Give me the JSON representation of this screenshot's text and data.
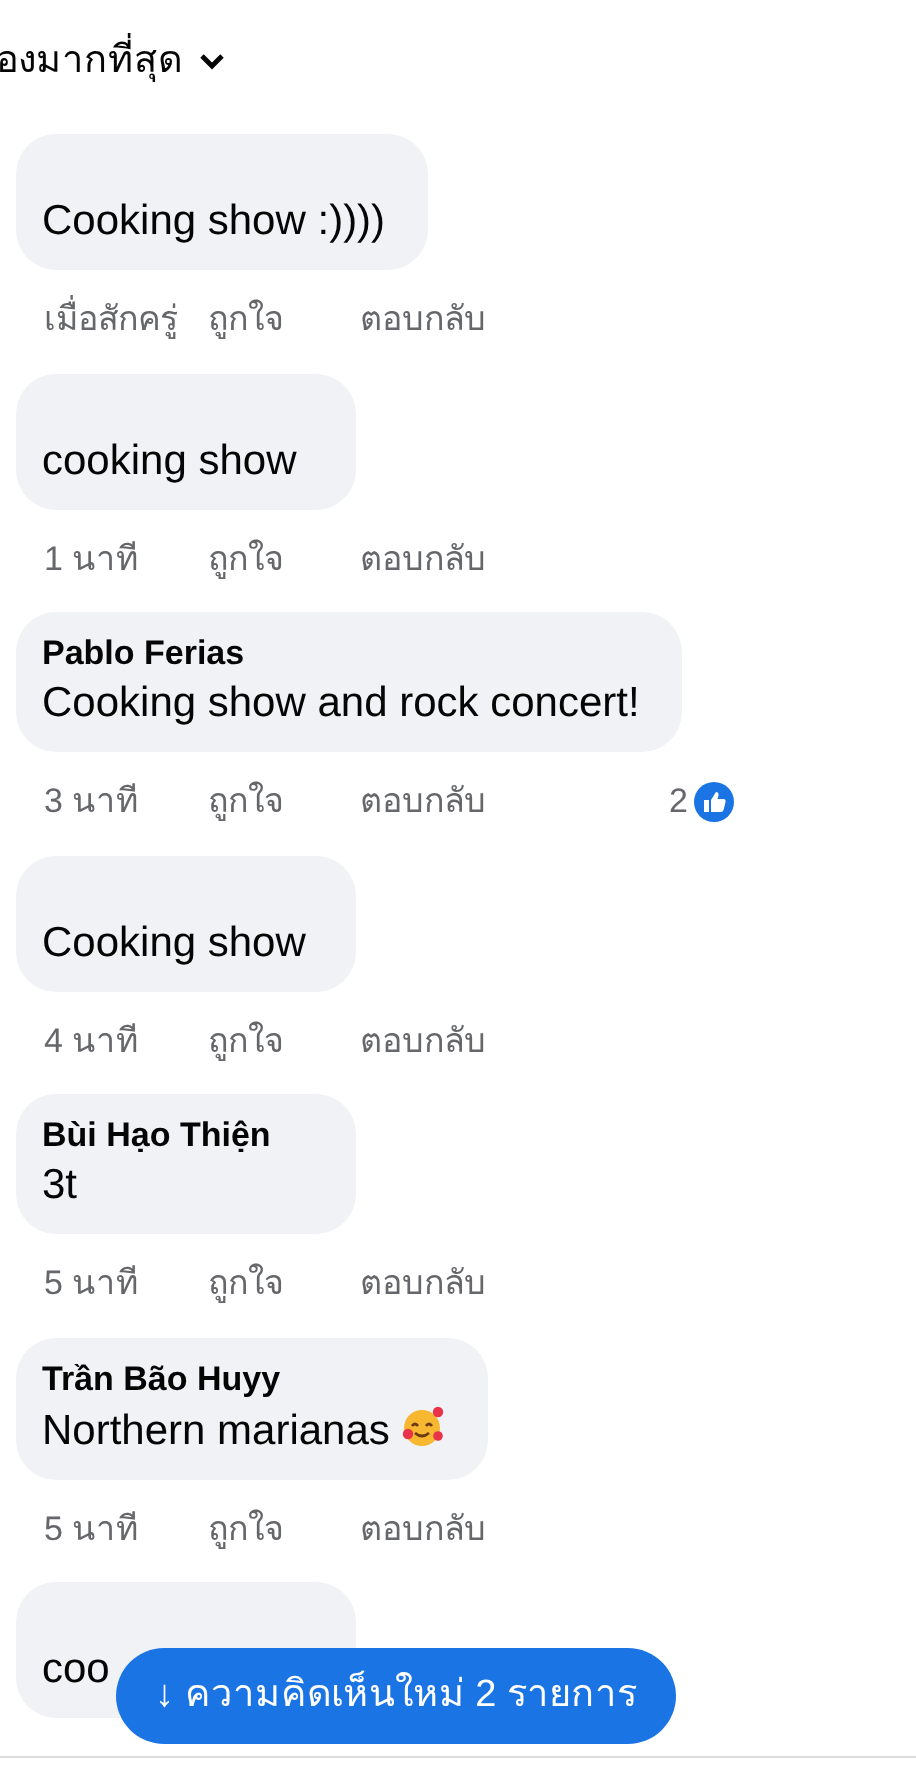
{
  "sort": {
    "label": "องมากที่สุด"
  },
  "comments": [
    {
      "text": "Cooking show :))))",
      "time": "เมื่อสักครู่",
      "like": "ถูกใจ",
      "reply": "ตอบกลับ"
    },
    {
      "text": "cooking show",
      "time": "1 นาที",
      "like": "ถูกใจ",
      "reply": "ตอบกลับ"
    },
    {
      "name": "Pablo Ferias",
      "text": "Cooking show and rock concert!",
      "time": "3 นาที",
      "like": "ถูกใจ",
      "reply": "ตอบกลับ",
      "likes": "2"
    },
    {
      "text": "Cooking show",
      "time": "4 นาที",
      "like": "ถูกใจ",
      "reply": "ตอบกลับ"
    },
    {
      "name": "Bùi Hạo Thiện",
      "text": "3t",
      "time": "5 นาที",
      "like": "ถูกใจ",
      "reply": "ตอบกลับ"
    },
    {
      "name": "Trần Bão Huyy",
      "text": "Northern marianas",
      "emoji": true,
      "time": "5 นาที",
      "like": "ถูกใจ",
      "reply": "ตอบกลับ"
    },
    {
      "text": "coo"
    }
  ],
  "new_comments_button": {
    "label": "↓ ความคิดเห็นใหม่ 2 รายการ"
  }
}
